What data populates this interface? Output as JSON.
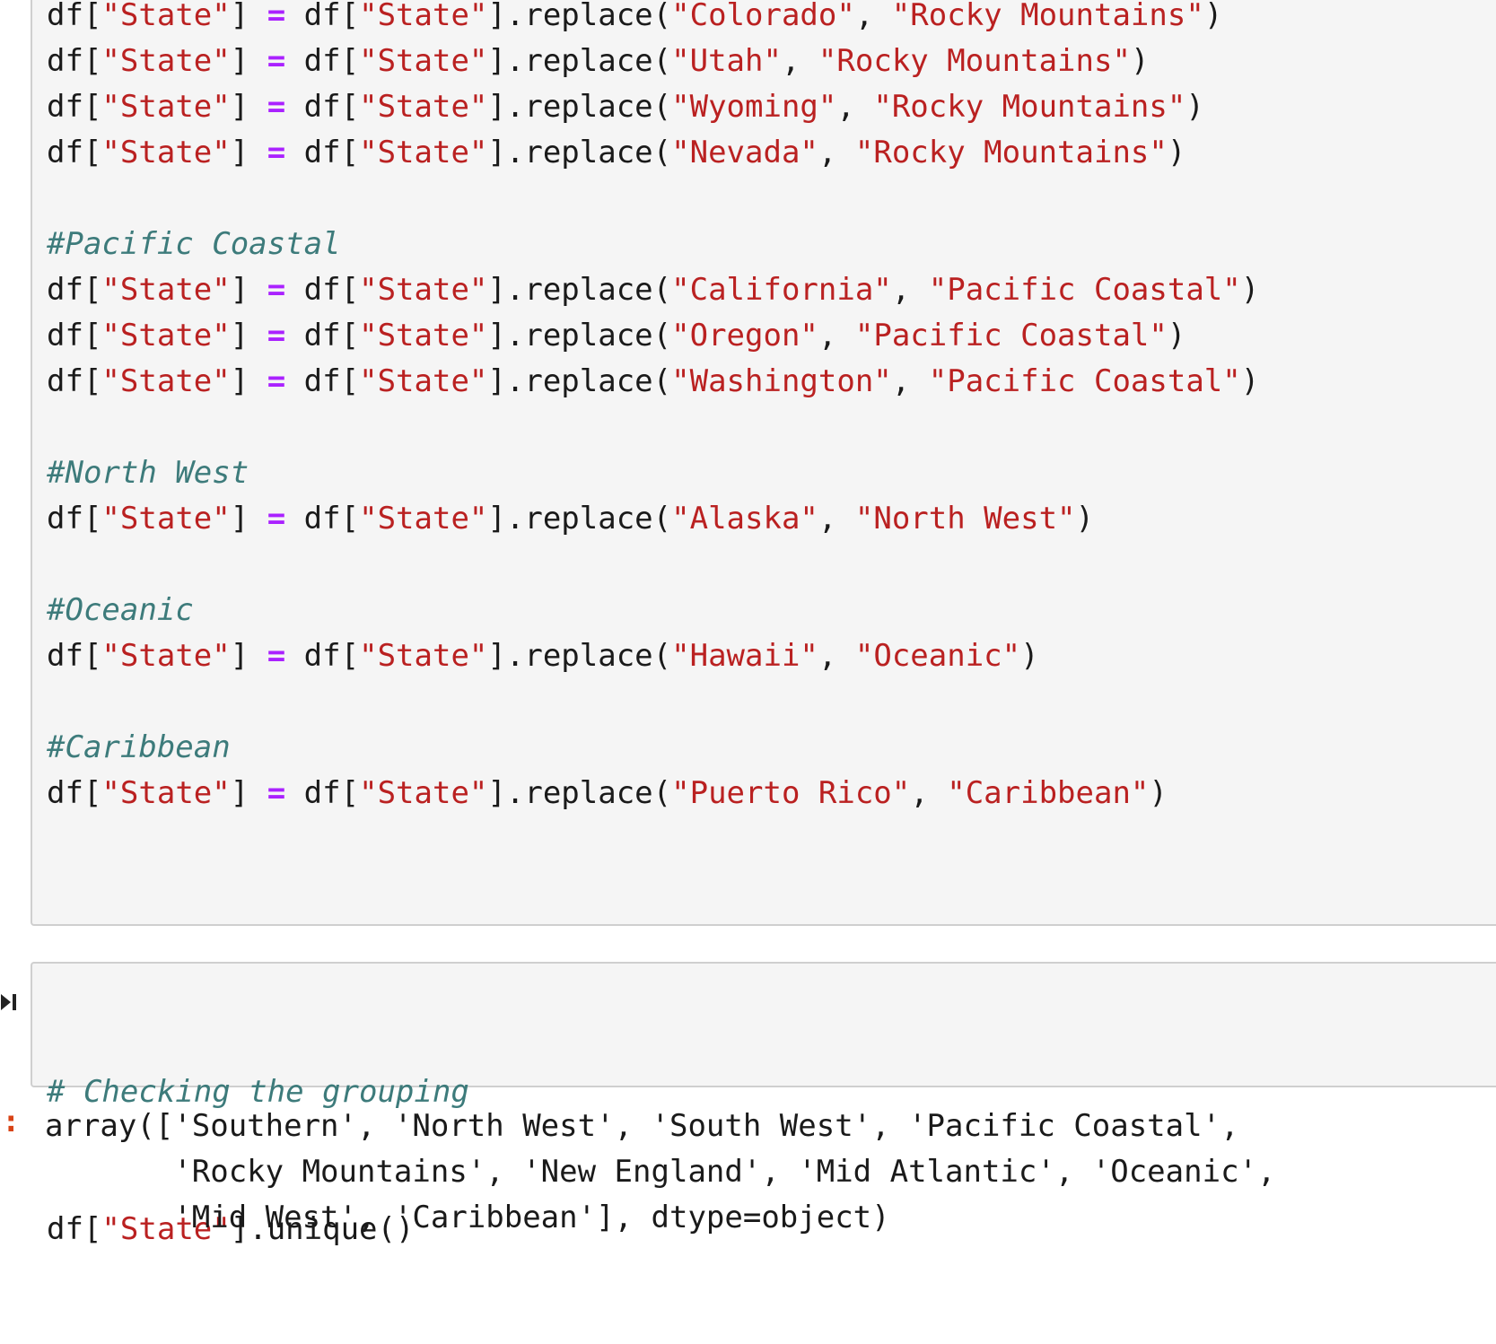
{
  "cell1": {
    "lines": [
      {
        "kind": "code",
        "target": "State",
        "from": "Colorado",
        "to": "Rocky Mountains"
      },
      {
        "kind": "code",
        "target": "State",
        "from": "Utah",
        "to": "Rocky Mountains"
      },
      {
        "kind": "code",
        "target": "State",
        "from": "Wyoming",
        "to": "Rocky Mountains"
      },
      {
        "kind": "code",
        "target": "State",
        "from": "Nevada",
        "to": "Rocky Mountains"
      },
      {
        "kind": "blank"
      },
      {
        "kind": "comment",
        "text": "#Pacific Coastal"
      },
      {
        "kind": "code",
        "target": "State",
        "from": "California",
        "to": "Pacific Coastal"
      },
      {
        "kind": "code",
        "target": "State",
        "from": "Oregon",
        "to": "Pacific Coastal"
      },
      {
        "kind": "code",
        "target": "State",
        "from": "Washington",
        "to": "Pacific Coastal"
      },
      {
        "kind": "blank"
      },
      {
        "kind": "comment",
        "text": "#North West"
      },
      {
        "kind": "code",
        "target": "State",
        "from": "Alaska",
        "to": "North West"
      },
      {
        "kind": "blank"
      },
      {
        "kind": "comment",
        "text": "#Oceanic"
      },
      {
        "kind": "code",
        "target": "State",
        "from": "Hawaii",
        "to": "Oceanic"
      },
      {
        "kind": "blank"
      },
      {
        "kind": "comment",
        "text": "#Caribbean"
      },
      {
        "kind": "code",
        "target": "State",
        "from": "Puerto Rico",
        "to": "Caribbean"
      }
    ]
  },
  "cell2": {
    "comment": "# Checking the grouping",
    "column": "State",
    "call": ".unique()"
  },
  "output": {
    "prompt": ":",
    "lines": [
      "array(['Southern', 'North West', 'South West', 'Pacific Coastal',",
      "       'Rocky Mountains', 'New England', 'Mid Atlantic', 'Oceanic',",
      "       'Mid West', 'Caribbean'], dtype=object)"
    ]
  },
  "icons": {
    "run": "run-cell-icon"
  }
}
